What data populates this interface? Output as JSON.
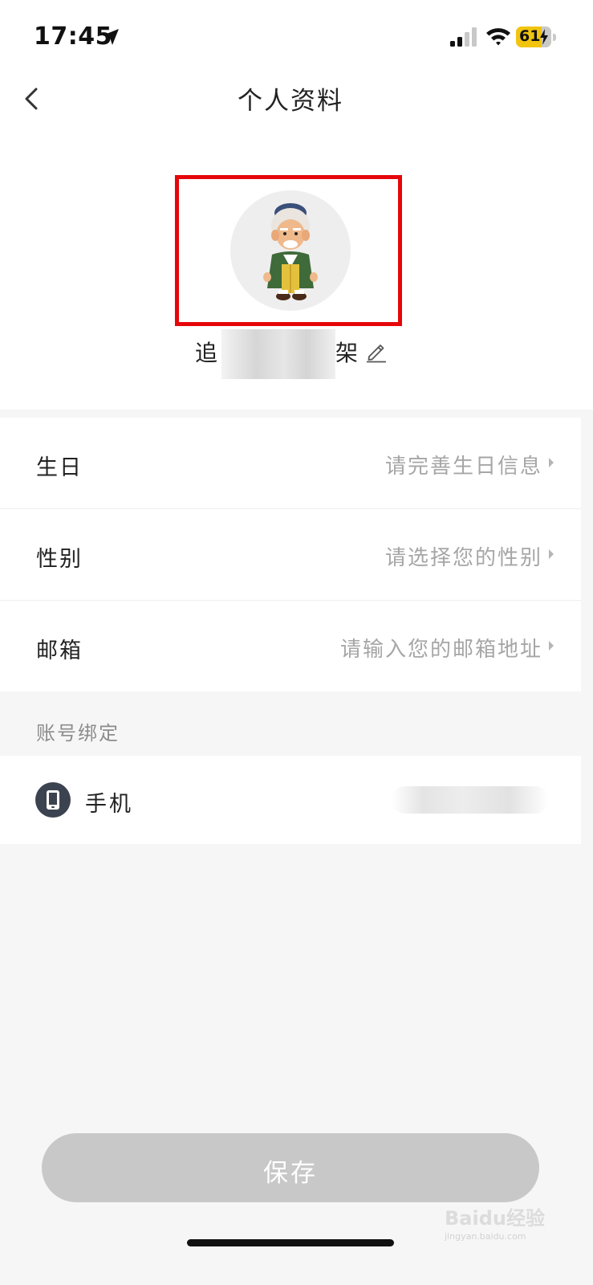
{
  "status_bar": {
    "time": "17:45",
    "battery": "61"
  },
  "header": {
    "title": "个人资料"
  },
  "profile": {
    "nickname_start": "追",
    "nickname_end": "架"
  },
  "list": {
    "items": [
      {
        "label": "生日",
        "value": "请完善生日信息"
      },
      {
        "label": "性别",
        "value": "请选择您的性别"
      },
      {
        "label": "邮箱",
        "value": "请输入您的邮箱地址"
      }
    ]
  },
  "binding": {
    "section_title": "账号绑定",
    "phone_label": "手机"
  },
  "footer": {
    "save_label": "保存"
  },
  "watermark": {
    "text": "Baidu经验",
    "sub": "jingyan.baidu.com"
  },
  "colors": {
    "highlight_frame": "#e5070a",
    "battery_fill": "#f1c40f",
    "save_disabled": "#c8c8c8",
    "phone_icon_bg": "#3c4350"
  }
}
